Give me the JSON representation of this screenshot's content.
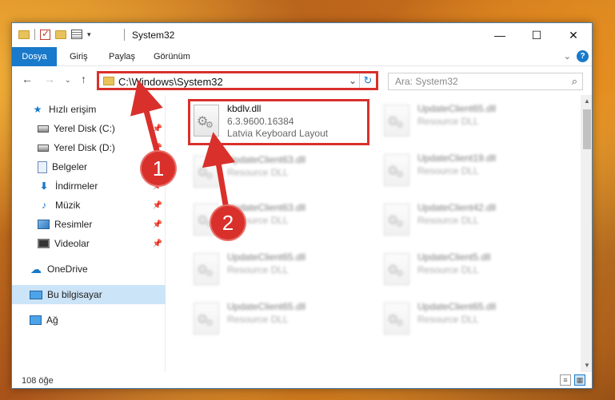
{
  "window": {
    "title": "System32",
    "controls": {
      "minimize": "—",
      "maximize": "☐",
      "close": "✕"
    }
  },
  "ribbon": {
    "tabs": [
      "Dosya",
      "Giriş",
      "Paylaş",
      "Görünüm"
    ],
    "help": "?"
  },
  "nav": {
    "address_path": "C:\\Windows\\System32",
    "search_placeholder": "Ara: System32"
  },
  "sidebar": {
    "items": [
      {
        "label": "Hızlı erişim",
        "icon": "star-icon",
        "pinned": false
      },
      {
        "label": "Yerel Disk (C:)",
        "icon": "disk-icon",
        "pinned": true
      },
      {
        "label": "Yerel Disk (D:)",
        "icon": "disk-icon",
        "pinned": true
      },
      {
        "label": "Belgeler",
        "icon": "document-icon",
        "pinned": true
      },
      {
        "label": "İndirmeler",
        "icon": "download-icon",
        "pinned": true
      },
      {
        "label": "Müzik",
        "icon": "music-icon",
        "pinned": true
      },
      {
        "label": "Resimler",
        "icon": "pictures-icon",
        "pinned": true
      },
      {
        "label": "Videolar",
        "icon": "video-icon",
        "pinned": true
      },
      {
        "label": "OneDrive",
        "icon": "cloud-icon",
        "pinned": false
      },
      {
        "label": "Bu bilgisayar",
        "icon": "computer-icon",
        "pinned": false,
        "selected": true
      },
      {
        "label": "Ağ",
        "icon": "network-icon",
        "pinned": false
      }
    ]
  },
  "files": {
    "highlighted": {
      "name": "kbdlv.dll",
      "version": "6.3.9600.16384",
      "description": "Latvia Keyboard Layout"
    },
    "left_column": [
      {
        "name": "UpdateClient63.dll",
        "type": "Resource DLL"
      },
      {
        "name": "UpdateClient63.dll",
        "type": "Resource DLL"
      },
      {
        "name": "UpdateClient65.dll",
        "type": "Resource DLL"
      },
      {
        "name": "UpdateClient65.dll",
        "type": "Resource DLL"
      }
    ],
    "right_column": [
      {
        "name": "UpdateClient65.dll",
        "type": "Resource DLL"
      },
      {
        "name": "UpdateClient19.dll",
        "type": "Resource DLL"
      },
      {
        "name": "UpdateClient42.dll",
        "type": "Resource DLL"
      },
      {
        "name": "UpdateClient5.dll",
        "type": "Resource DLL"
      },
      {
        "name": "UpdateClient65.dll",
        "type": "Resource DLL"
      }
    ]
  },
  "status": {
    "item_count": "108 öğe"
  },
  "callouts": [
    "1",
    "2"
  ],
  "colors": {
    "accent": "#1979ca",
    "callout": "#d9302c",
    "selection": "#cce4f7"
  }
}
